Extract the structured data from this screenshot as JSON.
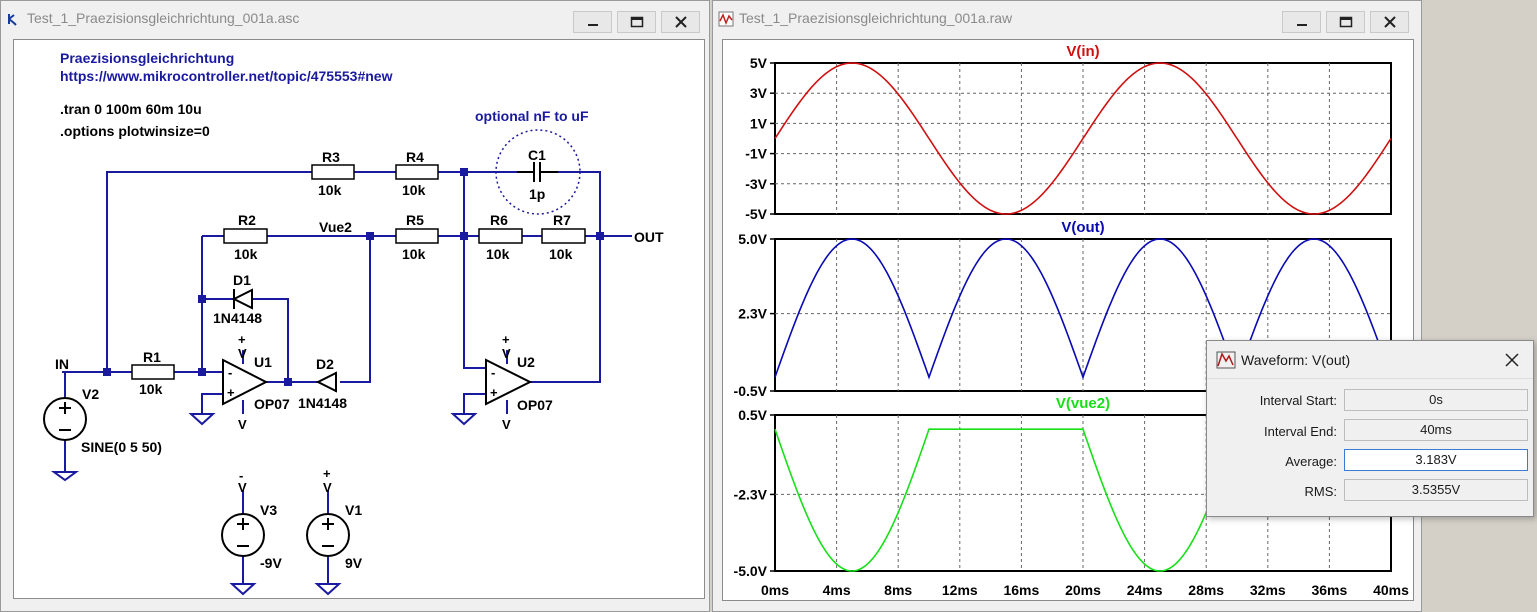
{
  "schematic_window": {
    "title": "Test_1_Praezisionsgleichrichtung_001a.asc",
    "comments": {
      "line1": "Praezisionsgleichrichtung",
      "line2": "https://www.mikrocontroller.net/topic/475553#new",
      "directive1": ".tran 0 100m 60m 10u",
      "directive2": ".options plotwinsize=0",
      "optional_note": "optional nF to uF"
    },
    "components": {
      "r1": {
        "name": "R1",
        "value": "10k"
      },
      "r2": {
        "name": "R2",
        "value": "10k"
      },
      "r3": {
        "name": "R3",
        "value": "10k"
      },
      "r4": {
        "name": "R4",
        "value": "10k"
      },
      "r5": {
        "name": "R5",
        "value": "10k"
      },
      "r6": {
        "name": "R6",
        "value": "10k"
      },
      "r7": {
        "name": "R7",
        "value": "10k"
      },
      "c1": {
        "name": "C1",
        "value": "1p"
      },
      "d1": {
        "name": "D1",
        "value": "1N4148"
      },
      "d2": {
        "name": "D2",
        "value": "1N4148"
      },
      "u1": {
        "name": "U1",
        "value": "OP07"
      },
      "u2": {
        "name": "U2",
        "value": "OP07"
      },
      "v1": {
        "name": "V1",
        "value": "9V"
      },
      "v2": {
        "name": "V2",
        "value": "SINE(0 5 50)"
      },
      "v3": {
        "name": "V3",
        "value": "-9V"
      }
    },
    "net_labels": {
      "in": "IN",
      "out": "OUT",
      "vue2": "Vue2"
    },
    "supply_symbols": {
      "plus": "+",
      "minus": "-",
      "v": "V"
    }
  },
  "waveform_window": {
    "title": "Test_1_Praezisionsgleichrichtung_001a.raw",
    "trace_colors": {
      "vin": "#d01010",
      "vout": "#0a0ab4",
      "vue2": "#18e018"
    },
    "x_tick_labels": [
      "0ms",
      "4ms",
      "8ms",
      "12ms",
      "16ms",
      "20ms",
      "24ms",
      "28ms",
      "32ms",
      "36ms",
      "40ms"
    ]
  },
  "chart_data": [
    {
      "type": "line",
      "title": "V(in)",
      "x_unit": "ms",
      "xlim": [
        0,
        40
      ],
      "ylim": [
        -5,
        5
      ],
      "y_tick_labels": [
        "5V",
        "3V",
        "1V",
        "-1V",
        "-3V",
        "-5V"
      ],
      "y_ticks": [
        5,
        3,
        1,
        -1,
        -3,
        -5
      ],
      "grid": true,
      "series": [
        {
          "x": [
            0,
            5,
            10,
            15,
            20,
            25,
            30,
            35,
            40
          ],
          "y": [
            0,
            5,
            0,
            -5,
            0,
            5,
            0,
            -5,
            0
          ]
        }
      ]
    },
    {
      "type": "line",
      "title": "V(out)",
      "x_unit": "ms",
      "xlim": [
        0,
        40
      ],
      "ylim": [
        -0.5,
        5.0
      ],
      "y_tick_labels": [
        "5.0V",
        "2.3V",
        "-0.5V"
      ],
      "y_ticks": [
        5.0,
        2.3,
        -0.5
      ],
      "grid": true,
      "series": [
        {
          "x": [
            0,
            5,
            10,
            15,
            20,
            25,
            30,
            35,
            40
          ],
          "y": [
            0,
            5,
            0,
            5,
            0,
            5,
            0,
            5,
            0
          ]
        }
      ]
    },
    {
      "type": "line",
      "title": "V(vue2)",
      "x_unit": "ms",
      "xlim": [
        0,
        40
      ],
      "ylim": [
        -5.0,
        0.5
      ],
      "y_tick_labels": [
        "0.5V",
        "-2.3V",
        "-5.0V"
      ],
      "y_ticks": [
        0.5,
        -2.3,
        -5.0
      ],
      "grid": true,
      "series": [
        {
          "x": [
            0,
            5,
            10,
            20,
            25,
            30,
            40
          ],
          "y": [
            0,
            -5,
            0,
            0,
            -5,
            0,
            0
          ]
        }
      ]
    }
  ],
  "waveform_dialog": {
    "title": "Waveform: V(out)",
    "fields": {
      "interval_start": {
        "label": "Interval Start:",
        "value": "0s"
      },
      "interval_end": {
        "label": "Interval End:",
        "value": "40ms"
      },
      "average": {
        "label": "Average:",
        "value": "3.183V"
      },
      "rms": {
        "label": "RMS:",
        "value": "3.5355V"
      }
    }
  },
  "icons": {
    "schematic_app": "ltspice-schematic-icon",
    "waveform_app": "ltspice-waveform-icon",
    "dialog": "waveform-probe-icon",
    "minimize": "minimize-icon",
    "maximize": "maximize-icon",
    "close": "close-icon"
  }
}
